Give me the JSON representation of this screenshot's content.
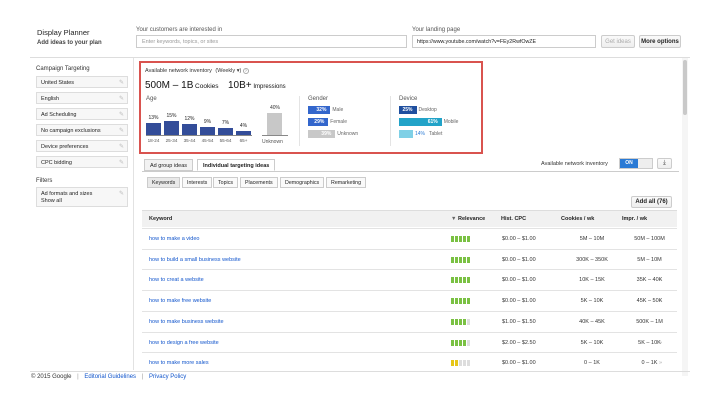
{
  "header": {
    "title": "Display Planner",
    "subtitle": "Add ideas to your plan",
    "customers_label": "Your customers are interested in",
    "customers_placeholder": "Enter keywords, topics, or sites",
    "landing_label": "Your landing page",
    "landing_value": "https://www.youtube.com/watch?v=FEy2RwfOwZE",
    "get_ideas": "Get ideas",
    "more_options": "More options"
  },
  "sidebar": {
    "campaign_targeting": "Campaign Targeting",
    "items": [
      "United States",
      "English",
      "Ad Scheduling",
      "No campaign exclusions",
      "Device preferences",
      "CPC bidding"
    ],
    "filters": "Filters",
    "filter_item_1": "Ad formats and sizes",
    "filter_item_2": "Show all"
  },
  "inventory": {
    "title": "Available network inventory",
    "period": "(Weekly",
    "cookies_value": "500M – 1B",
    "cookies_label": "Cookies",
    "impressions_value": "10B+",
    "impressions_label": "Impressions",
    "age_label": "Age",
    "age": [
      {
        "label": "18-24",
        "pct": "13%",
        "value": 13
      },
      {
        "label": "25-34",
        "pct": "15%",
        "value": 15
      },
      {
        "label": "35-44",
        "pct": "12%",
        "value": 12
      },
      {
        "label": "45-54",
        "pct": "9%",
        "value": 9
      },
      {
        "label": "55-64",
        "pct": "7%",
        "value": 7
      },
      {
        "label": "65+",
        "pct": "4%",
        "value": 4
      }
    ],
    "unknown_age_pct": "40%",
    "unknown_age_label": "Unknown",
    "gender_label": "Gender",
    "gender": [
      {
        "label": "Male",
        "pct": "32%",
        "value": 32,
        "color": "#3366cc"
      },
      {
        "label": "Female",
        "pct": "29%",
        "value": 29,
        "color": "#3366cc"
      },
      {
        "label": "Unknown",
        "pct": "39%",
        "value": 39,
        "color": "#c8c8c8"
      }
    ],
    "device_label": "Device",
    "device": [
      {
        "label": "Desktop",
        "pct": "25%",
        "value": 25,
        "color": "#1f4f9f"
      },
      {
        "label": "Mobile",
        "pct": "61%",
        "value": 61,
        "color": "#22a3c8"
      },
      {
        "label": "Tablet",
        "pct": "14%",
        "value": 14,
        "color": "#7fd0e6"
      }
    ]
  },
  "tabs": {
    "ad_group": "Ad group ideas",
    "individual": "Individual targeting ideas",
    "toggle_label": "Available network inventory",
    "toggle_state": "ON",
    "sub": [
      "Keywords",
      "Interests",
      "Topics",
      "Placements",
      "Demographics",
      "Remarketing"
    ],
    "add_all": "Add all (76)"
  },
  "table": {
    "headers": {
      "keyword": "Keyword",
      "relevance": "Relevance",
      "cpc": "Hist. CPC",
      "cookies": "Cookies / wk",
      "impr": "Impr. / wk"
    },
    "rows": [
      {
        "keyword": "how to make a video",
        "relevance": 5,
        "cpc": "$0.00 – $1.00",
        "cookies": "5M – 10M",
        "impr": "50M – 100M",
        "color": "#7ac143"
      },
      {
        "keyword": "how to build a small business website",
        "relevance": 5,
        "cpc": "$0.00 – $1.00",
        "cookies": "300K – 350K",
        "impr": "5M – 10M",
        "color": "#7ac143"
      },
      {
        "keyword": "how to creat a website",
        "relevance": 5,
        "cpc": "$0.00 – $1.00",
        "cookies": "10K – 15K",
        "impr": "35K – 40K",
        "color": "#7ac143"
      },
      {
        "keyword": "how to make free website",
        "relevance": 5,
        "cpc": "$0.00 – $1.00",
        "cookies": "5K – 10K",
        "impr": "45K – 50K",
        "color": "#7ac143"
      },
      {
        "keyword": "how to make business website",
        "relevance": 4,
        "cpc": "$1.00 – $1.50",
        "cookies": "40K – 45K",
        "impr": "500K – 1M",
        "color": "#7ac143"
      },
      {
        "keyword": "how to design a free website",
        "relevance": 4,
        "cpc": "$2.00 – $2.50",
        "cookies": "5K – 10K",
        "impr": "5K – 10K",
        "color": "#7ac143"
      },
      {
        "keyword": "how to make more sales",
        "relevance": 2,
        "cpc": "$0.00 – $1.00",
        "cookies": "0 – 1K",
        "impr": "0 – 1K",
        "color": "#e6c619"
      }
    ]
  },
  "footer": {
    "copyright": "© 2015 Google",
    "guidelines": "Editorial Guidelines",
    "privacy": "Privacy Policy"
  }
}
